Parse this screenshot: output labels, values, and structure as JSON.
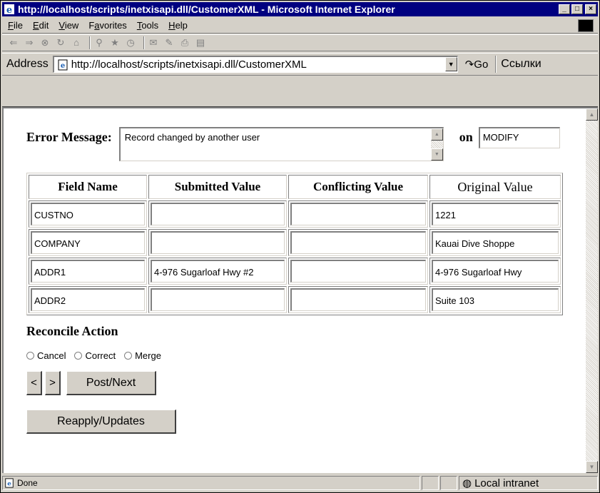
{
  "window": {
    "title": "http://localhost/scripts/inetxisapi.dll/CustomerXML - Microsoft Internet Explorer"
  },
  "menu": {
    "items": [
      {
        "label": "File",
        "key": "F",
        "rest": "ile"
      },
      {
        "label": "Edit",
        "key": "E",
        "rest": "dit"
      },
      {
        "label": "View",
        "key": "V",
        "rest": "iew"
      },
      {
        "label": "Favorites",
        "pre": "F",
        "key": "a",
        "rest": "vorites"
      },
      {
        "label": "Tools",
        "key": "T",
        "rest": "ools"
      },
      {
        "label": "Help",
        "key": "H",
        "rest": "elp"
      }
    ]
  },
  "address": {
    "label": "Address",
    "url": "http://localhost/scripts/inetxisapi.dll/CustomerXML",
    "go_label": "Go",
    "links_label": "Ссылки"
  },
  "form": {
    "error_label": "Error Message:",
    "error_text": "Record changed by another user",
    "on_label": "on",
    "operation": "MODIFY",
    "columns": [
      "Field Name",
      "Submitted Value",
      "Conflicting Value",
      "Original Value"
    ],
    "rows": [
      [
        "CUSTNO",
        "",
        "",
        "1221"
      ],
      [
        "COMPANY",
        "",
        "",
        "Kauai Dive Shoppe"
      ],
      [
        "ADDR1",
        "4-976 Sugarloaf Hwy #2",
        "",
        "4-976 Sugarloaf Hwy"
      ],
      [
        "ADDR2",
        "",
        "",
        "Suite 103"
      ]
    ],
    "reconcile_title": "Reconcile Action",
    "actions": [
      "Cancel",
      "Correct",
      "Merge"
    ],
    "prev_label": "<",
    "next_label": ">",
    "post_next_label": "Post/Next",
    "reapply_label": "Reapply/Updates"
  },
  "status": {
    "text": "Done",
    "zone": "Local intranet"
  },
  "colors": {
    "titlebar": "#000080",
    "chrome": "#d4d0c8"
  }
}
